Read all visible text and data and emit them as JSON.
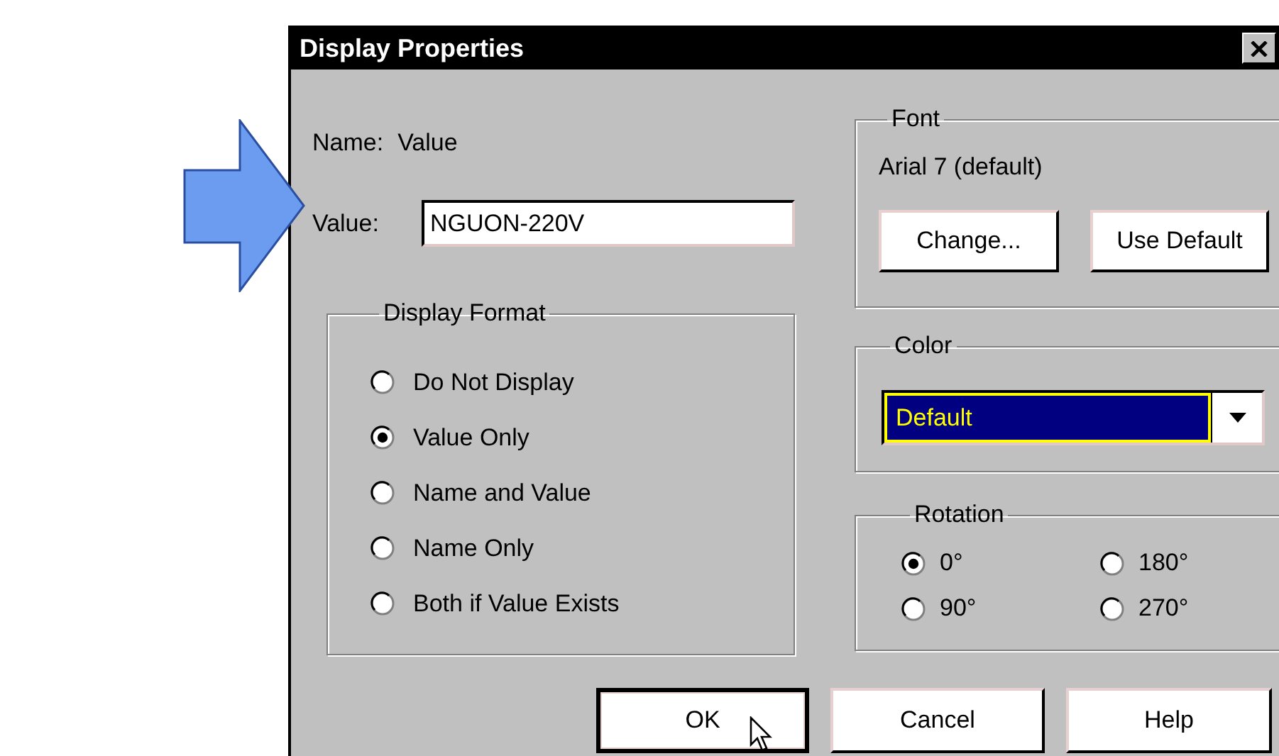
{
  "window": {
    "title": "Display Properties"
  },
  "name_row": {
    "label": "Name:",
    "value": "Value"
  },
  "value_field": {
    "label": "Value:",
    "value": "NGUON-220V"
  },
  "display_format": {
    "title": "Display Format",
    "options": [
      {
        "label": "Do Not Display",
        "selected": false
      },
      {
        "label": "Value Only",
        "selected": true
      },
      {
        "label": "Name and Value",
        "selected": false
      },
      {
        "label": "Name Only",
        "selected": false
      },
      {
        "label": "Both if Value Exists",
        "selected": false
      }
    ]
  },
  "font": {
    "title": "Font",
    "current": "Arial 7 (default)",
    "buttons": [
      {
        "label": "Change..."
      },
      {
        "label": "Use Default"
      }
    ]
  },
  "color": {
    "title": "Color",
    "value": "Default"
  },
  "rotation": {
    "title": "Rotation",
    "options": [
      {
        "label": "0°",
        "selected": true
      },
      {
        "label": "180°",
        "selected": false
      },
      {
        "label": "90°",
        "selected": false
      },
      {
        "label": "270°",
        "selected": false
      }
    ]
  },
  "buttons": [
    {
      "label": "OK",
      "default": true
    },
    {
      "label": "Cancel",
      "default": false
    },
    {
      "label": "Help",
      "default": false
    }
  ]
}
